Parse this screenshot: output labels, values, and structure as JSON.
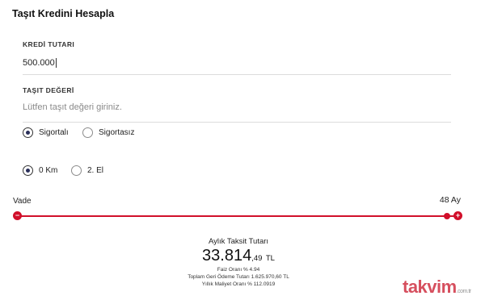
{
  "header": {
    "title": "Taşıt Kredini Hesapla"
  },
  "loan_amount": {
    "label": "KREDİ TUTARI",
    "value": "500.000"
  },
  "vehicle_value": {
    "label": "TAŞIT DEĞERİ",
    "placeholder": "Lütfen taşıt değeri giriniz."
  },
  "insurance": {
    "options": [
      {
        "label": "Sigortalı",
        "selected": true
      },
      {
        "label": "Sigortasız",
        "selected": false
      }
    ]
  },
  "condition": {
    "options": [
      {
        "label": "0 Km",
        "selected": true
      },
      {
        "label": "2. El",
        "selected": false
      }
    ]
  },
  "term": {
    "label": "Vade",
    "value": "48 Ay",
    "position_fraction": 1.0
  },
  "result": {
    "title": "Aylık Taksit Tutarı",
    "amount_integer": "33.814",
    "amount_decimal": ",49",
    "currency": "TL",
    "interest_rate": "Faiz Oranı % 4.94",
    "total_repayment": "Toplam Geri Ödeme Tutarı 1.625.970,60 TL",
    "annual_cost_rate": "Yıllık Maliyet Oranı % 112.0919"
  },
  "watermark": {
    "text": "takvim",
    "suffix": ".com.tr"
  },
  "colors": {
    "accent": "#d10f2a",
    "radio_fill": "#2a2f5a"
  }
}
